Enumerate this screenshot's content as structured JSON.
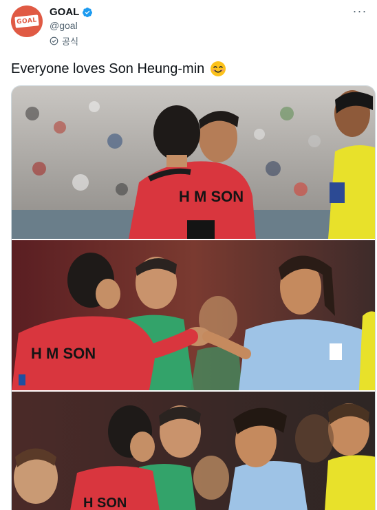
{
  "account": {
    "display_name": "GOAL",
    "handle": "@goal",
    "official_label": "공식",
    "avatar_logo_text": "GOAL"
  },
  "tweet": {
    "text": "Everyone loves Son Heung-min",
    "emoji": "smiling-face-icon"
  },
  "media": {
    "photos": [
      {
        "jersey_text": "H M SON"
      },
      {
        "jersey_text": "H M SON"
      },
      {
        "jersey_text": "H SON"
      }
    ]
  },
  "colors": {
    "brand": "#e05a44",
    "verified": "#1d9bf0",
    "korea_red": "#d9363e",
    "uruguay_blue": "#9ec3e6",
    "referee_yellow": "#e8e12a"
  }
}
